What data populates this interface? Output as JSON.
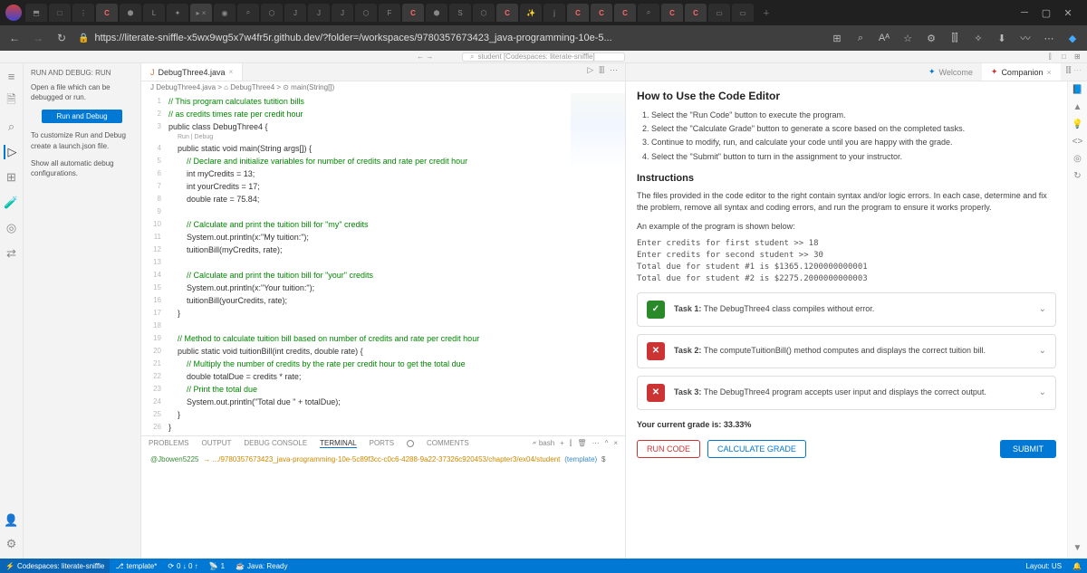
{
  "browser": {
    "url": "https://literate-sniffle-x5wx9wg5x7w4fr5r.github.dev/?folder=/workspaces/9780357673423_java-programming-10e-5...",
    "tabs_count": 30
  },
  "cmdcenter": "student [Codespaces: literate-sniffle]",
  "sidebar": {
    "title": "RUN AND DEBUG: RUN",
    "open_text": "Open a file which can be debugged or run.",
    "run_btn": "Run and Debug",
    "customize_text": "To customize Run and Debug create a launch.json file.",
    "show_text": "Show all automatic debug configurations."
  },
  "editor": {
    "tab": "DebugThree4.java",
    "breadcrumb": "J DebugThree4.java > ⌂ DebugThree4 > ⊙ main(String[])",
    "codelens": "Run | Debug",
    "lines": [
      {
        "n": 1,
        "t": "// This program calculates tutition bills",
        "cls": "cmt"
      },
      {
        "n": 2,
        "t": "// as credits times rate per credit hour",
        "cls": "cmt"
      },
      {
        "n": 3,
        "t": "public class DebugThree4 {",
        "cls": ""
      },
      {
        "n": 4,
        "t": "    public static void main(String args[]) {",
        "cls": ""
      },
      {
        "n": 5,
        "t": "        // Declare and initialize variables for number of credits and rate per credit hour",
        "cls": "cmt"
      },
      {
        "n": 6,
        "t": "        int myCredits = 13;",
        "cls": ""
      },
      {
        "n": 7,
        "t": "        int yourCredits = 17;",
        "cls": ""
      },
      {
        "n": 8,
        "t": "        double rate = 75.84;",
        "cls": ""
      },
      {
        "n": 9,
        "t": "",
        "cls": ""
      },
      {
        "n": 10,
        "t": "        // Calculate and print the tuition bill for \"my\" credits",
        "cls": "cmt"
      },
      {
        "n": 11,
        "t": "        System.out.println(x:\"My tuition:\");",
        "cls": ""
      },
      {
        "n": 12,
        "t": "        tuitionBill(myCredits, rate);",
        "cls": ""
      },
      {
        "n": 13,
        "t": "",
        "cls": ""
      },
      {
        "n": 14,
        "t": "        // Calculate and print the tuition bill for \"your\" credits",
        "cls": "cmt"
      },
      {
        "n": 15,
        "t": "        System.out.println(x:\"Your tuition:\");",
        "cls": ""
      },
      {
        "n": 16,
        "t": "        tuitionBill(yourCredits, rate);",
        "cls": ""
      },
      {
        "n": 17,
        "t": "    }",
        "cls": ""
      },
      {
        "n": 18,
        "t": "",
        "cls": ""
      },
      {
        "n": 19,
        "t": "    // Method to calculate tuition bill based on number of credits and rate per credit hour",
        "cls": "cmt"
      },
      {
        "n": 20,
        "t": "    public static void tuitionBill(int credits, double rate) {",
        "cls": ""
      },
      {
        "n": 21,
        "t": "        // Multiply the number of credits by the rate per credit hour to get the total due",
        "cls": "cmt"
      },
      {
        "n": 22,
        "t": "        double totalDue = credits * rate;",
        "cls": ""
      },
      {
        "n": 23,
        "t": "        // Print the total due",
        "cls": "cmt"
      },
      {
        "n": 24,
        "t": "        System.out.println(\"Total due \" + totalDue);",
        "cls": ""
      },
      {
        "n": 25,
        "t": "    }",
        "cls": ""
      },
      {
        "n": 26,
        "t": "}",
        "cls": ""
      }
    ]
  },
  "terminal": {
    "tabs": [
      "PROBLEMS",
      "OUTPUT",
      "DEBUG CONSOLE",
      "TERMINAL",
      "PORTS",
      "COMMENTS"
    ],
    "active_tab": 3,
    "shell_label": "bash",
    "prompt_user": "@Jbowen5225",
    "prompt_path": "→ .../9780357673423_java-programming-10e-5c89f3cc-c0c6-4288-9a22-37326c920453/chapter3/ex04/student",
    "prompt_branch": "(template)",
    "prompt_end": "$"
  },
  "right": {
    "tabs": {
      "welcome": "Welcome",
      "companion": "Companion"
    },
    "heading": "How to Use the Code Editor",
    "steps": [
      "Select the \"Run Code\" button to execute the program.",
      "Select the \"Calculate Grade\" button to generate a score based on the completed tasks.",
      "Continue to modify, run, and calculate your code until you are happy with the grade.",
      "Select the \"Submit\" button to turn in the assignment to your instructor."
    ],
    "instr_heading": "Instructions",
    "instr_para": "The files provided in the code editor to the right contain syntax and/or logic errors. In each case, determine and fix the problem, remove all syntax and coding errors, and run the program to ensure it works properly.",
    "example_lead": "An example of the program is shown below:",
    "example": "Enter credits for first student >> 18\nEnter credits for second student >> 30\nTotal due for student #1 is $1365.1200000000001\nTotal due for student #2 is $2275.2000000000003",
    "tasks": [
      {
        "pass": true,
        "label": "Task 1:",
        "text": "The DebugThree4 class compiles without error."
      },
      {
        "pass": false,
        "label": "Task 2:",
        "text": "The computeTuitionBill() method computes and displays the correct tuition bill."
      },
      {
        "pass": false,
        "label": "Task 3:",
        "text": "The DebugThree4 program accepts user input and displays the correct output."
      }
    ],
    "grade": "Your current grade is: 33.33%",
    "run_code": "RUN CODE",
    "calc_grade": "CALCULATE GRADE",
    "submit": "SUBMIT"
  },
  "statusbar": {
    "remote": "Codespaces: literate-sniffle",
    "branch": "template*",
    "sync": "0 ↓ 0 ↑",
    "ports": "1",
    "java": "Java: Ready",
    "layout": "Layout: US"
  }
}
